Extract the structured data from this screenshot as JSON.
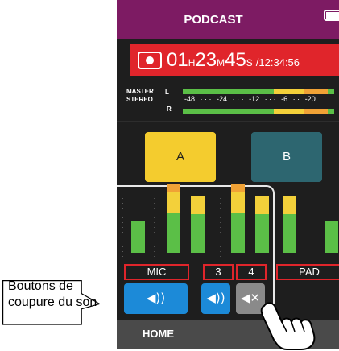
{
  "header": {
    "title": "PODCAST",
    "battery_icon": "battery-full-icon"
  },
  "recorder": {
    "rec_icon": "record-icon",
    "elapsed_hours": "01",
    "hours_unit": "H",
    "elapsed_minutes": "23",
    "minutes_unit": "M",
    "elapsed_seconds": "45",
    "seconds_unit": "S",
    "remaining": "/12:34:56"
  },
  "master": {
    "label_line1": "MASTER",
    "label_line2": "STEREO",
    "left": "L",
    "right": "R",
    "scale": [
      "-48",
      "-24",
      "-12",
      "-6",
      "-20"
    ],
    "left_level": 0.96,
    "right_level": 0.96
  },
  "pads": {
    "a_label": "A",
    "b_label": "B"
  },
  "channels": [
    {
      "label": "MIC",
      "mute_icon": "speaker-on-icon",
      "muted": false
    },
    {
      "label": "3",
      "mute_icon": "speaker-on-icon",
      "muted": false
    },
    {
      "label": "4",
      "mute_icon": "speaker-muted-icon",
      "muted": true
    },
    {
      "label": "PAD"
    }
  ],
  "home": {
    "label": "HOME"
  },
  "callout": {
    "text": "Boutons de coupure du son"
  },
  "colors": {
    "title_bar": "#7d1b63",
    "record_red": "#e0252b",
    "mute_on_blue": "#1c8ad8",
    "mute_off_gray": "#8a8a8a",
    "pad_a_yellow": "#f4cc2e",
    "pad_b_teal": "#2d6670",
    "meter_green": "#5bbf47",
    "meter_yellow": "#f3d03a",
    "meter_orange": "#f0a236"
  }
}
